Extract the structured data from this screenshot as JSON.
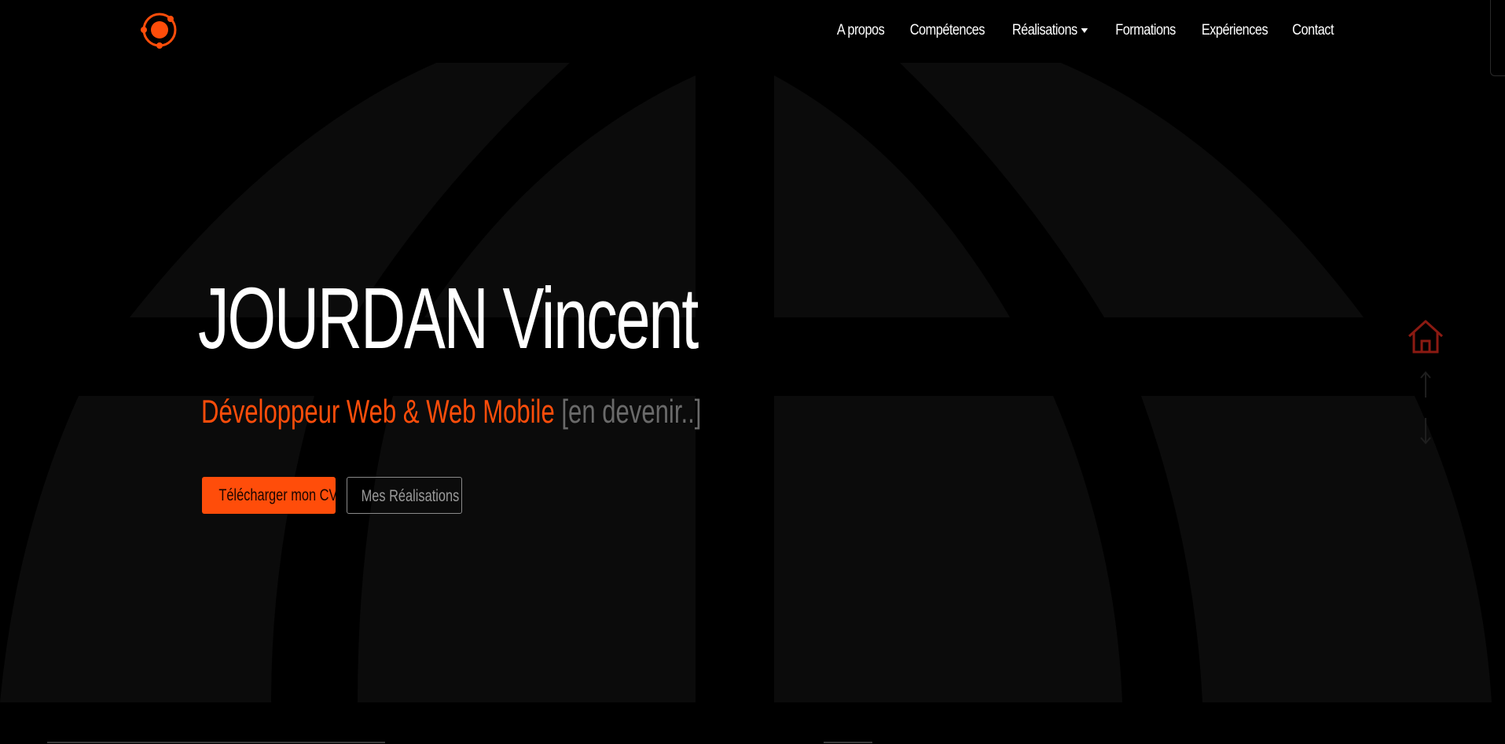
{
  "navbar": {
    "logo_icon": "orbit-logo-icon",
    "links": [
      {
        "label": "A propos"
      },
      {
        "label": "Compétences"
      },
      {
        "label": "Réalisations",
        "dropdown": true
      },
      {
        "label": "Formations"
      },
      {
        "label": "Expériences"
      },
      {
        "label": "Contact"
      }
    ]
  },
  "hero": {
    "name": "JOURDAN Vincent",
    "subtitle_main": "Développeur Web & Web Mobile",
    "subtitle_extra": "[en devenir..]",
    "cv_button": "Télécharger mon CV",
    "realisations_button": "Mes Réalisations"
  },
  "side_nav": {
    "home_icon": "home-icon",
    "up_icon": "arrow-up-icon",
    "down_icon": "arrow-down-icon"
  },
  "colors": {
    "accent": "#ff4d0a",
    "background": "#000000",
    "shape": "#0b0b0b",
    "home_icon": "#8b1a12",
    "muted_text": "#6a6a6a"
  }
}
